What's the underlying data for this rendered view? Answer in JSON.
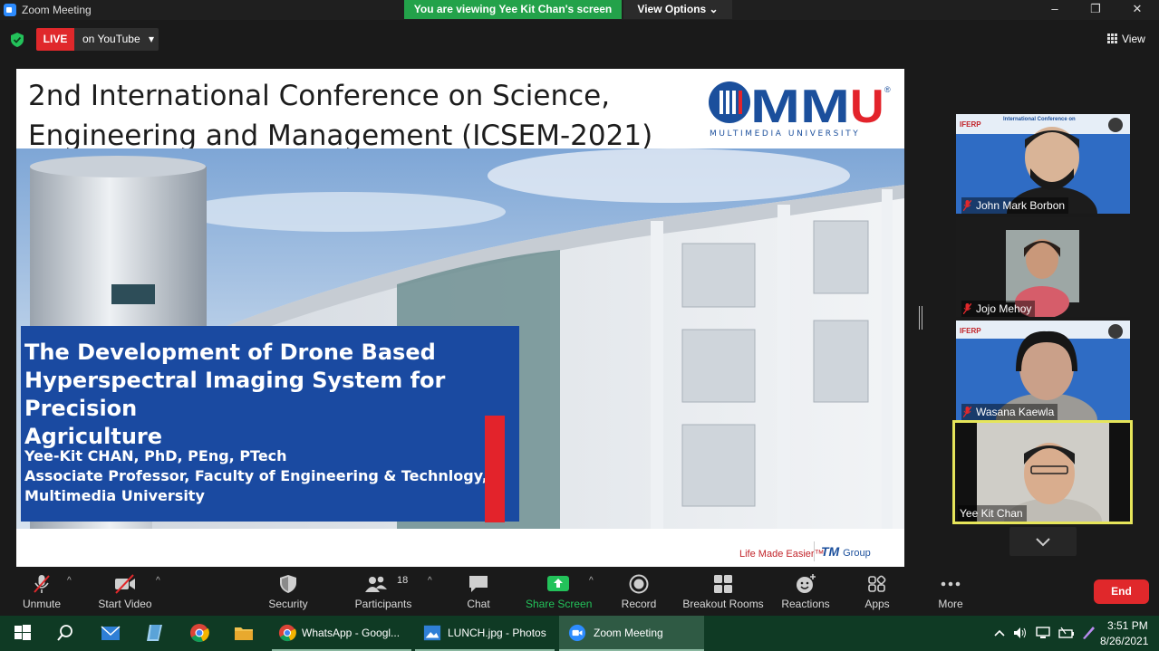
{
  "window": {
    "title": "Zoom Meeting",
    "minimize": "–",
    "restore": "❐",
    "close": "✕"
  },
  "banner": {
    "viewing": "You are viewing Yee Kit Chan's screen",
    "view_options": "View Options ⌄"
  },
  "topstrip": {
    "live": "LIVE",
    "live_on": "on YouTube",
    "caret": "▾",
    "view": "View"
  },
  "slide": {
    "title_line1": "2nd International Conference on Science,",
    "title_line2": "Engineering and Management (ICSEM-2021)",
    "logo_text": "MMU",
    "logo_registered": "®",
    "logo_subtext": "MULTIMEDIA UNIVERSITY",
    "topic_line1": "The Development of Drone Based",
    "topic_line2": "Hyperspectral Imaging System for Precision",
    "topic_line3": "Agriculture",
    "presenter_line1": "Yee-Kit CHAN, PhD, PEng, PTech",
    "presenter_line2": "Associate Professor, Faculty of Engineering & Technlogy,",
    "presenter_line3": "Multimedia University",
    "footer_slogan": "Life Made Easier™",
    "footer_brand": "TM",
    "footer_brand_suffix": "Group"
  },
  "participants": [
    {
      "name": "John Mark Borbon",
      "muted": true,
      "backdrop_title": "International Conference on",
      "backdrop_org": "IFERP"
    },
    {
      "name": "Jojo Mehoy",
      "muted": true
    },
    {
      "name": "Wasana Kaewla",
      "muted": true,
      "backdrop_org": "IFERP"
    },
    {
      "name": "Yee Kit Chan",
      "muted": false,
      "active_speaker": true
    }
  ],
  "toolbar": {
    "unmute": "Unmute",
    "start_video": "Start Video",
    "security": "Security",
    "participants": "Participants",
    "participants_count": "18",
    "chat": "Chat",
    "share_screen": "Share Screen",
    "record": "Record",
    "breakout_rooms": "Breakout Rooms",
    "reactions": "Reactions",
    "apps": "Apps",
    "more": "More",
    "end": "End",
    "caret": "^"
  },
  "taskbar": {
    "apps": [
      {
        "label": "WhatsApp - Googl...",
        "icon": "chrome-icon"
      },
      {
        "label": "LUNCH.jpg - Photos",
        "icon": "photos-icon"
      },
      {
        "label": "Zoom Meeting",
        "icon": "zoom-icon",
        "active": true
      }
    ],
    "time": "3:51 PM",
    "date": "8/26/2021"
  },
  "colors": {
    "live_red": "#e0282b",
    "banner_green": "#23a24a",
    "slide_blue": "#1a4aa1",
    "mmu_blue": "#1b4f9c",
    "mmu_red": "#e3232b",
    "active_speaker": "#e6e55a",
    "taskbar": "#0f3a24"
  }
}
